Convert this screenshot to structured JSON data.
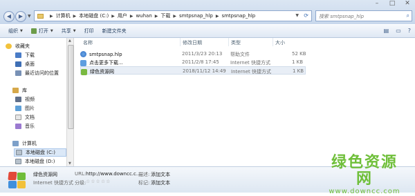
{
  "window": {
    "controls": [
      "–",
      "□",
      "✕"
    ]
  },
  "address": {
    "crumbs": [
      "计算机",
      "本地磁盘 (C:)",
      "用户",
      "wuhan",
      "下载",
      "smtpsnap_hlp",
      "smtpsnap_hlp"
    ],
    "search_placeholder": "搜索 smtpsnap_hlp"
  },
  "toolbar": {
    "organize": "组织",
    "open": "打开",
    "share": "共享",
    "print": "打印",
    "new_folder": "新建文件夹"
  },
  "nav": {
    "favorites": "收藏夹",
    "downloads": "下载",
    "desktop": "桌面",
    "recent": "最近访问的位置",
    "libraries": "库",
    "videos": "视频",
    "pictures": "图片",
    "documents": "文档",
    "music": "音乐",
    "computer": "计算机",
    "disk_c": "本地磁盘 (C:)",
    "disk_d": "本地磁盘 (D:)"
  },
  "columns": {
    "name": "名称",
    "date": "修改日期",
    "type": "类型",
    "size": "大小"
  },
  "files": [
    {
      "name": "smtpsnap.hlp",
      "date": "2011/3/23 20:13",
      "type": "帮助文件",
      "size": "52 KB",
      "icon": "help-file-icon"
    },
    {
      "name": "点击更多下载...",
      "date": "2011/2/8 17:45",
      "type": "Internet 快捷方式",
      "size": "1 KB",
      "icon": "internet-shortcut-icon"
    },
    {
      "name": "绿色资源网",
      "date": "2018/11/12 14:49",
      "type": "Internet 快捷方式",
      "size": "1 KB",
      "icon": "green-site-icon"
    }
  ],
  "details": {
    "name": "绿色资源网",
    "kind": "Internet 快捷方式",
    "url_label": "URL:",
    "url_value": "http://www.downcc.c...",
    "rating_label": "分级:",
    "rating_value": "☆☆☆☆☆",
    "desc_label": "描述:",
    "desc_value": "添加文本",
    "tags_label": "标记:",
    "tags_value": "添加文本"
  },
  "watermark": {
    "title": "绿色资源网",
    "url": "www.downcc.com"
  }
}
